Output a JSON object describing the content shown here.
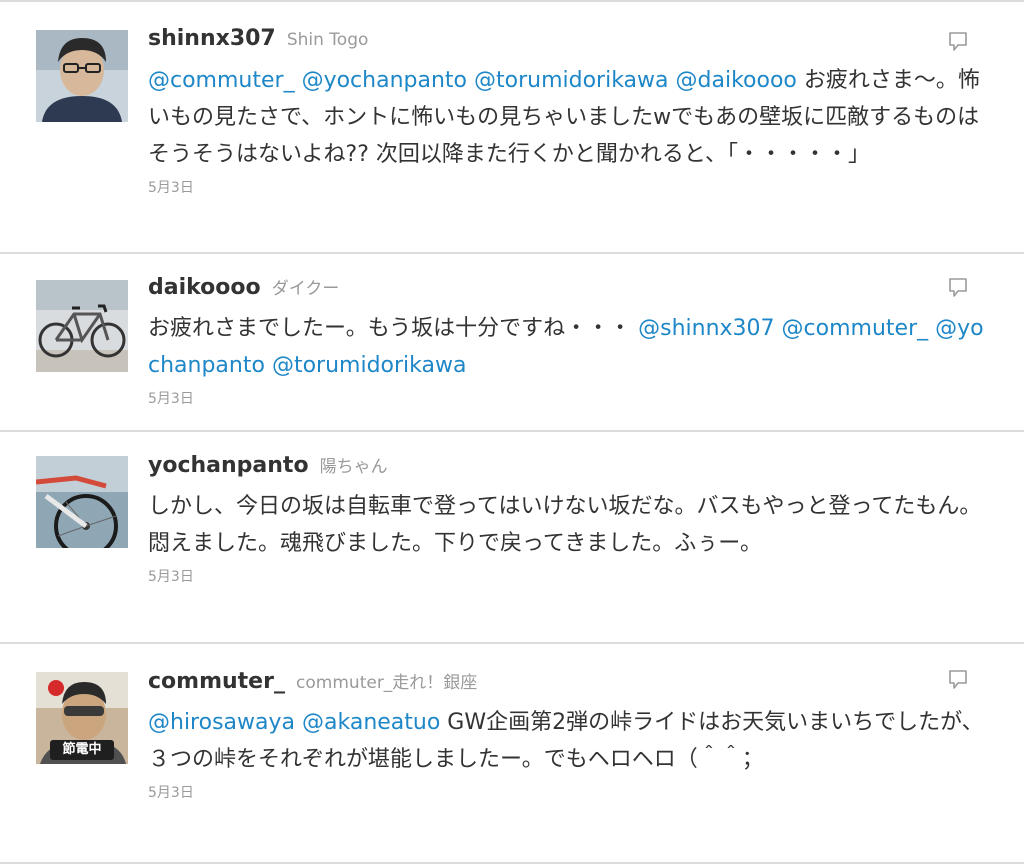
{
  "tweets": [
    {
      "screen_name": "shinnx307",
      "full_name": "Shin Togo",
      "segments": [
        {
          "text": "@commuter_",
          "type": "mention"
        },
        {
          "text": " ",
          "type": "text"
        },
        {
          "text": "@yochanpanto",
          "type": "mention"
        },
        {
          "text": " ",
          "type": "text"
        },
        {
          "text": "@torumidorikawa",
          "type": "mention"
        },
        {
          "text": " ",
          "type": "text"
        },
        {
          "text": "@daikoooo",
          "type": "mention"
        },
        {
          "text": " お疲れさま～。怖いもの見たさで、ホントに怖いもの見ちゃいましたwでもあの壁坂に匹敵するものはそうそうはないよね?? 次回以降また行くかと聞かれると、「・・・・・」",
          "type": "text"
        }
      ],
      "timestamp": "5月3日",
      "avatar_icon": "user-photo-icon",
      "has_reply_icon": true
    },
    {
      "screen_name": "daikoooo",
      "full_name": "ダイクー",
      "segments": [
        {
          "text": "お疲れさまでしたー。もう坂は十分ですね・・・ ",
          "type": "text"
        },
        {
          "text": "@shinnx307",
          "type": "mention"
        },
        {
          "text": " ",
          "type": "text"
        },
        {
          "text": "@commuter_",
          "type": "mention"
        },
        {
          "text": " ",
          "type": "text"
        },
        {
          "text": "@yochanpanto",
          "type": "mention"
        },
        {
          "text": " ",
          "type": "text"
        },
        {
          "text": "@torumidorikawa",
          "type": "mention"
        }
      ],
      "timestamp": "5月3日",
      "avatar_icon": "bicycle-photo-icon",
      "has_reply_icon": true
    },
    {
      "screen_name": "yochanpanto",
      "full_name": "陽ちゃん",
      "segments": [
        {
          "text": "しかし、今日の坂は自転車で登ってはいけない坂だな。バスもやっと登ってたもん。悶えました。魂飛びました。下りで戻ってきました。ふぅー。",
          "type": "text"
        }
      ],
      "timestamp": "5月3日",
      "avatar_icon": "bicycle-wheel-photo-icon",
      "has_reply_icon": false
    },
    {
      "screen_name": "commuter_",
      "full_name": "commuter_走れ！銀座",
      "segments": [
        {
          "text": "@hirosawaya",
          "type": "mention"
        },
        {
          "text": " ",
          "type": "text"
        },
        {
          "text": "@akaneatuo",
          "type": "mention"
        },
        {
          "text": " GW企画第2弾の峠ライドはお天気いまいちでしたが、３つの峠をそれぞれが堪能しましたー。でもヘロヘロ（＾＾；",
          "type": "text"
        }
      ],
      "timestamp": "5月3日",
      "avatar_icon": "user-photo-icon",
      "avatar_badge": "節電中",
      "has_reply_icon": true
    }
  ],
  "colors": {
    "mention": "#1e87c8",
    "text": "#333333",
    "meta": "#9a9a9a",
    "separator": "#dcdcdc"
  }
}
